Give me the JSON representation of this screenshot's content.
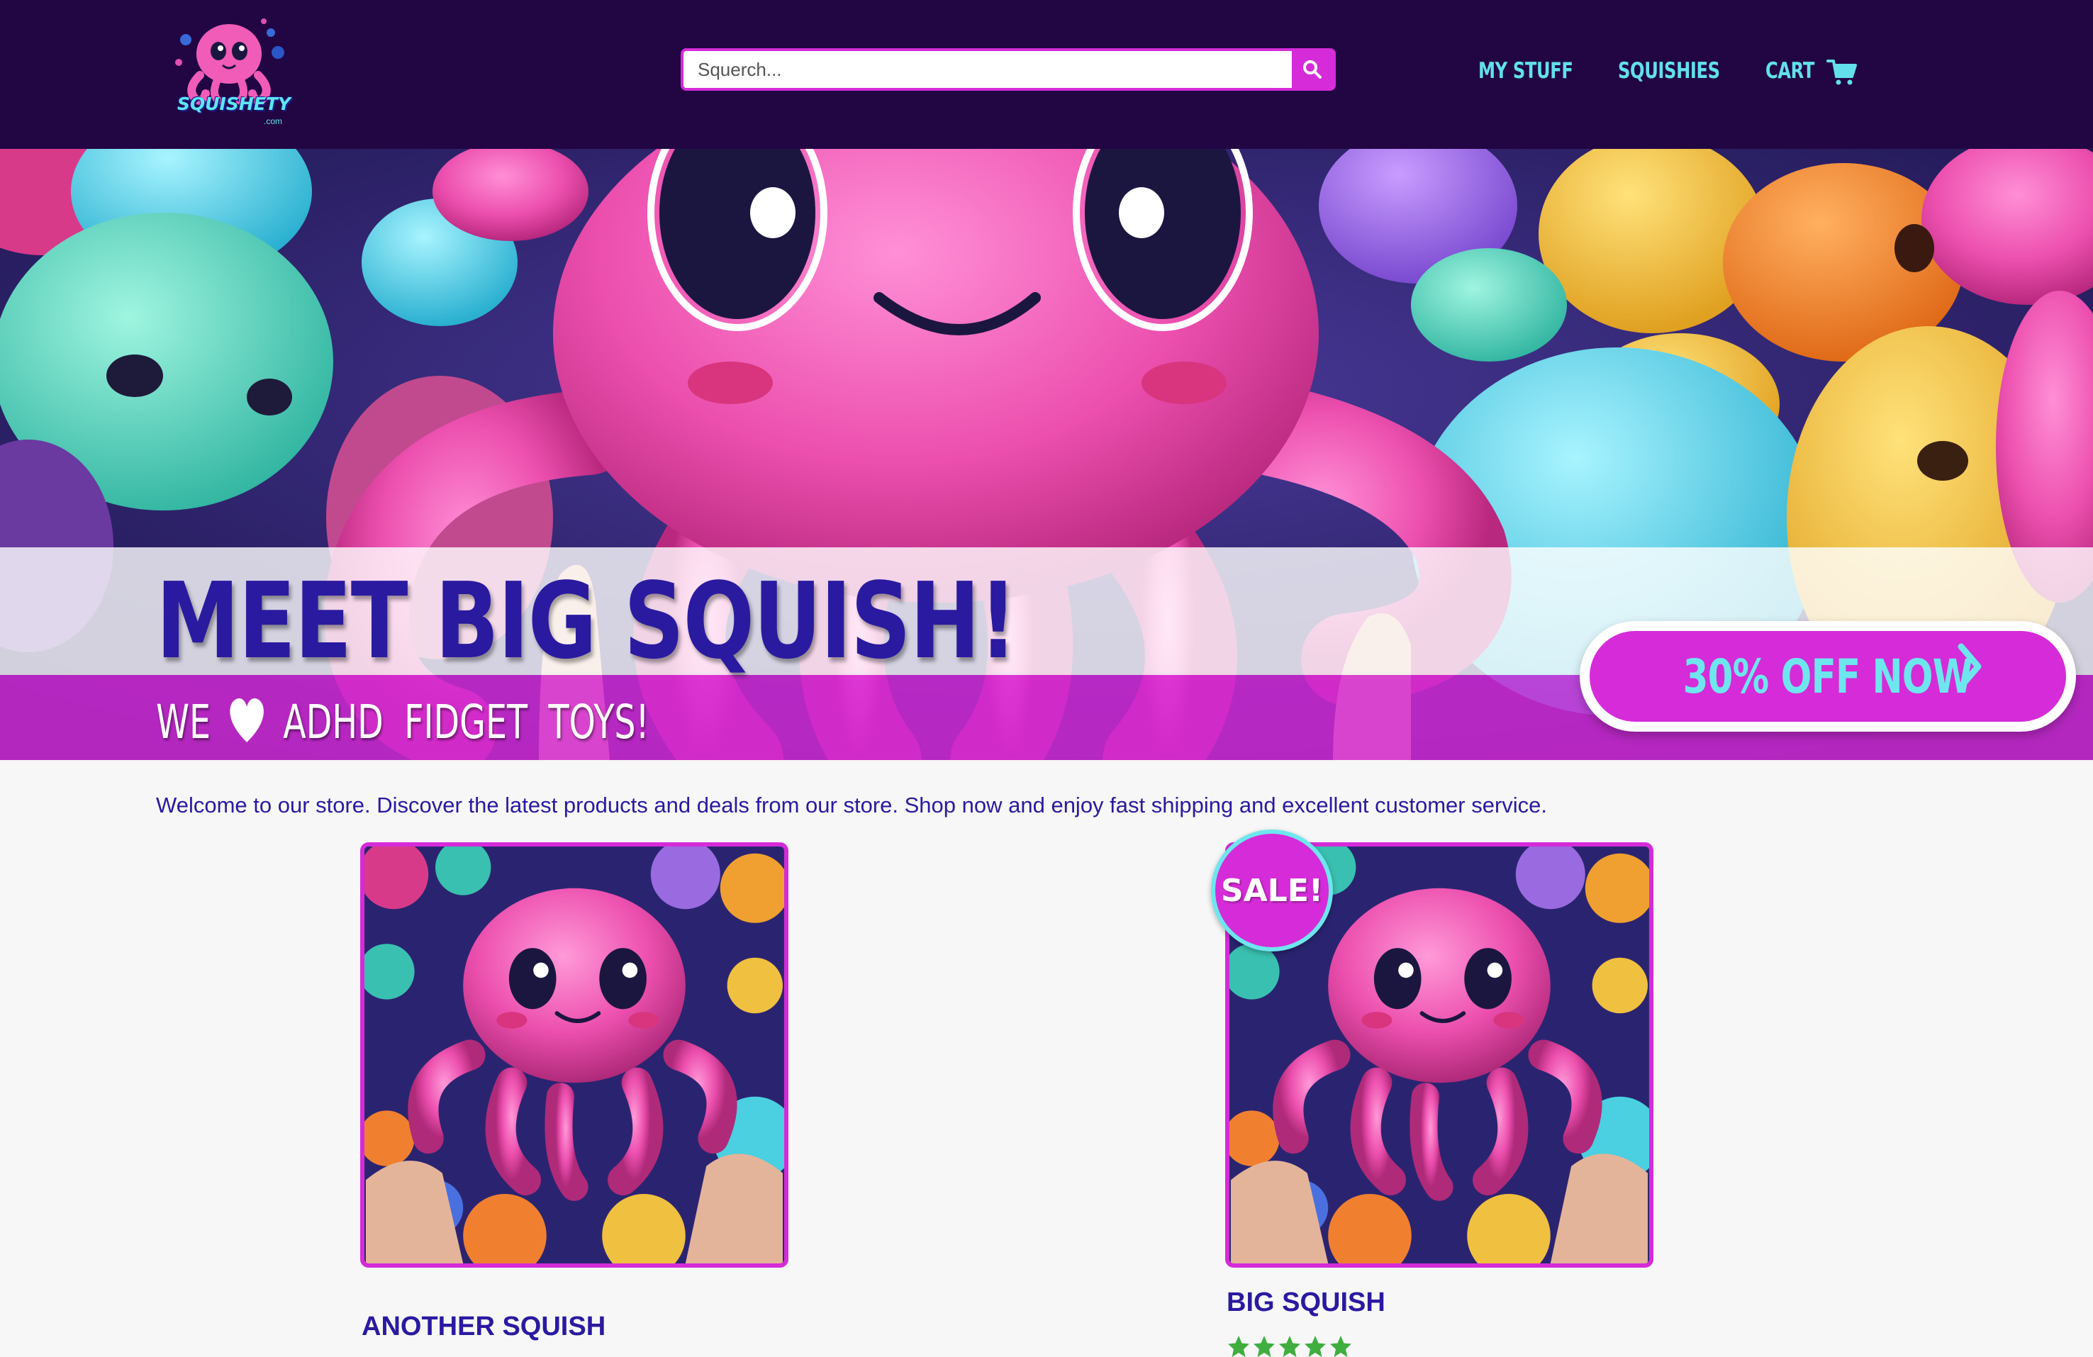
{
  "header": {
    "logo_text": "SQUISHETY",
    "logo_sub": ".com",
    "search_placeholder": "Squerch...",
    "nav": {
      "my_stuff": "MY STUFF",
      "squishies": "SQUISHIES",
      "cart": "CART"
    }
  },
  "hero": {
    "title": "MEET BIG SQUISH!",
    "subtitle_we": "WE",
    "subtitle_rest": "ADHD FIDGET TOYS!",
    "cta_label": "30% OFF NOW"
  },
  "main": {
    "welcome": "Welcome to our store. Discover the latest products and deals from our store. Shop now and enjoy fast shipping and excellent customer service.",
    "products": [
      {
        "name": "ANOTHER SQUISH",
        "on_sale": false
      },
      {
        "name": "BIG SQUISH",
        "on_sale": true,
        "badge": "SALE!",
        "rating": 5
      }
    ]
  },
  "colors": {
    "header_bg": "#220644",
    "accent_pink": "#d52bd8",
    "accent_cyan": "#62e0ec",
    "text_indigo": "#2a1aa0",
    "star_green": "#3fae3f"
  },
  "icons": {
    "search": "search-icon",
    "cart": "cart-icon",
    "heart": "heart-icon",
    "chevron": "chevron-right-icon",
    "star": "star-icon"
  }
}
